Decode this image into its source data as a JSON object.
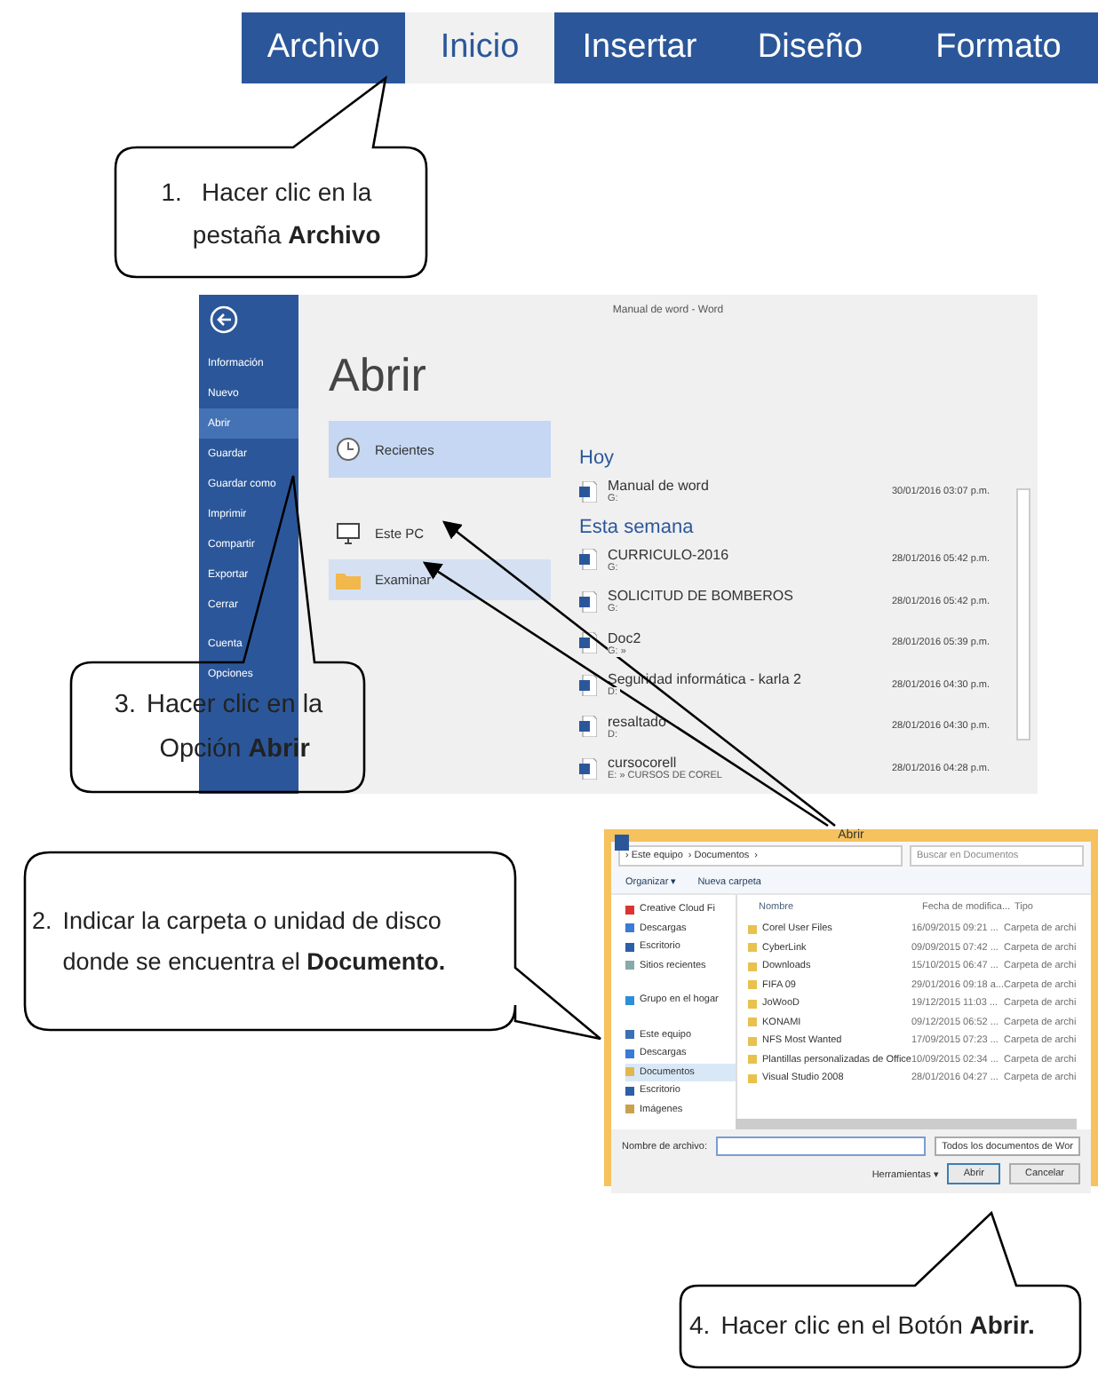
{
  "ribbon_tabs": [
    {
      "label": "Archivo",
      "selected": false
    },
    {
      "label": "Inicio",
      "selected": true
    },
    {
      "label": "Insertar",
      "selected": false
    },
    {
      "label": "Diseño",
      "selected": false
    },
    {
      "label": "Formato",
      "selected": false
    }
  ],
  "word_window": {
    "title": "Manual de word - Word",
    "heading": "Abrir",
    "sidebar": [
      {
        "label": "Información",
        "selected": false
      },
      {
        "label": "Nuevo",
        "selected": false
      },
      {
        "label": "Abrir",
        "selected": true
      },
      {
        "label": "Guardar",
        "selected": false
      },
      {
        "label": "Guardar como",
        "selected": false
      },
      {
        "label": "Imprimir",
        "selected": false
      },
      {
        "label": "Compartir",
        "selected": false
      },
      {
        "label": "Exportar",
        "selected": false
      },
      {
        "label": "Cerrar",
        "selected": false
      },
      {
        "label": "Cuenta",
        "selected": false
      },
      {
        "label": "Opciones",
        "selected": false
      }
    ],
    "places": [
      {
        "label": "Recientes",
        "kind": "clock",
        "selected": true,
        "hovered": false
      },
      {
        "label": "Este PC",
        "kind": "computer",
        "selected": false,
        "hovered": false
      },
      {
        "label": "Examinar",
        "kind": "folder",
        "selected": false,
        "hovered": true
      }
    ],
    "groups": [
      {
        "label": "Hoy",
        "files": [
          {
            "name": "Manual de word",
            "path": "G:",
            "date": "30/01/2016 03:07 p.m."
          }
        ]
      },
      {
        "label": "Esta semana",
        "files": [
          {
            "name": "CURRICULO-2016",
            "path": "G:",
            "date": "28/01/2016 05:42 p.m."
          },
          {
            "name": "SOLICITUD DE BOMBEROS",
            "path": "G:",
            "date": "28/01/2016 05:42 p.m."
          },
          {
            "name": "Doc2",
            "path": "G: »",
            "date": "28/01/2016 05:39 p.m."
          },
          {
            "name": "Seguridad informática - karla 2",
            "path": "D:",
            "date": "28/01/2016 04:30 p.m."
          },
          {
            "name": "resaltado",
            "path": "D:",
            "date": "28/01/2016 04:30 p.m."
          },
          {
            "name": "cursocorell",
            "path": "E: » CURSOS DE COREL",
            "date": "28/01/2016 04:28 p.m."
          }
        ]
      }
    ]
  },
  "open_dialog": {
    "title": "Abrir",
    "breadcrumb": [
      "› Este equipo",
      "› Documentos",
      "›"
    ],
    "search_placeholder": "Buscar en Documentos",
    "toolbar": [
      "Organizar ▾",
      "Nueva carpeta"
    ],
    "nav": [
      {
        "label": "Creative Cloud Fi",
        "kind": "cloud",
        "selected": false
      },
      {
        "label": "Descargas",
        "kind": "download",
        "selected": false
      },
      {
        "label": "Escritorio",
        "kind": "desktop",
        "selected": false
      },
      {
        "label": "Sitios recientes",
        "kind": "recent",
        "selected": false
      },
      {
        "label": "Grupo en el hogar",
        "kind": "homegroup",
        "selected": false
      },
      {
        "label": "Este equipo",
        "kind": "computer",
        "selected": false
      },
      {
        "label": "Descargas",
        "kind": "download",
        "selected": false
      },
      {
        "label": "Documentos",
        "kind": "documents",
        "selected": true
      },
      {
        "label": "Escritorio",
        "kind": "desktop",
        "selected": false
      },
      {
        "label": "Imágenes",
        "kind": "pictures",
        "selected": false
      }
    ],
    "columns": [
      "Nombre",
      "Fecha de modifica...",
      "Tipo"
    ],
    "rows": [
      [
        "Corel User Files",
        "16/09/2015 09:21 ...",
        "Carpeta de archi"
      ],
      [
        "CyberLink",
        "09/09/2015 07:42 ...",
        "Carpeta de archi"
      ],
      [
        "Downloads",
        "15/10/2015 06:47 ...",
        "Carpeta de archi"
      ],
      [
        "FIFA 09",
        "29/01/2016 09:18 a...",
        "Carpeta de archi"
      ],
      [
        "JoWooD",
        "19/12/2015 11:03 ...",
        "Carpeta de archi"
      ],
      [
        "KONAMI",
        "09/12/2015 06:52 ...",
        "Carpeta de archi"
      ],
      [
        "NFS Most Wanted",
        "17/09/2015 07:23 ...",
        "Carpeta de archi"
      ],
      [
        "Plantillas personalizadas de Office",
        "10/09/2015 02:34 ...",
        "Carpeta de archi"
      ],
      [
        "Visual Studio 2008",
        "28/01/2016 04:27 ...",
        "Carpeta de archi"
      ]
    ],
    "filename_label": "Nombre de archivo:",
    "filetype": "Todos los documentos de Wor",
    "tools": "Herramientas ▾",
    "open_button": "Abrir",
    "cancel_button": "Cancelar"
  },
  "callouts": [
    {
      "number": "1.",
      "lines": [
        "Hacer clic en la",
        "pestaña **Archivo**"
      ]
    },
    {
      "number": "3.",
      "lines": [
        "Hacer clic en la",
        "Opción **Abrir**"
      ]
    },
    {
      "number": "2.",
      "lines": [
        "Indicar la carpeta o unidad de disco",
        "donde se encuentra el **Documento.**"
      ]
    },
    {
      "number": "4.",
      "lines": [
        "Hacer clic en el Botón **Abrir.**"
      ]
    }
  ]
}
